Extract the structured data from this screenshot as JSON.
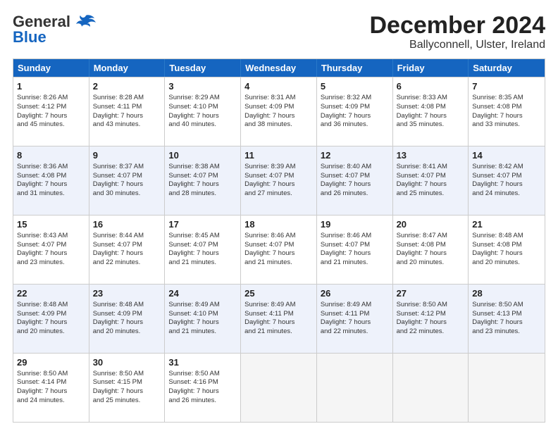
{
  "header": {
    "logo_general": "General",
    "logo_blue": "Blue",
    "title": "December 2024",
    "subtitle": "Ballyconnell, Ulster, Ireland"
  },
  "weekdays": [
    "Sunday",
    "Monday",
    "Tuesday",
    "Wednesday",
    "Thursday",
    "Friday",
    "Saturday"
  ],
  "rows": [
    [
      {
        "day": "1",
        "lines": [
          "Sunrise: 8:26 AM",
          "Sunset: 4:12 PM",
          "Daylight: 7 hours",
          "and 45 minutes."
        ]
      },
      {
        "day": "2",
        "lines": [
          "Sunrise: 8:28 AM",
          "Sunset: 4:11 PM",
          "Daylight: 7 hours",
          "and 43 minutes."
        ]
      },
      {
        "day": "3",
        "lines": [
          "Sunrise: 8:29 AM",
          "Sunset: 4:10 PM",
          "Daylight: 7 hours",
          "and 40 minutes."
        ]
      },
      {
        "day": "4",
        "lines": [
          "Sunrise: 8:31 AM",
          "Sunset: 4:09 PM",
          "Daylight: 7 hours",
          "and 38 minutes."
        ]
      },
      {
        "day": "5",
        "lines": [
          "Sunrise: 8:32 AM",
          "Sunset: 4:09 PM",
          "Daylight: 7 hours",
          "and 36 minutes."
        ]
      },
      {
        "day": "6",
        "lines": [
          "Sunrise: 8:33 AM",
          "Sunset: 4:08 PM",
          "Daylight: 7 hours",
          "and 35 minutes."
        ]
      },
      {
        "day": "7",
        "lines": [
          "Sunrise: 8:35 AM",
          "Sunset: 4:08 PM",
          "Daylight: 7 hours",
          "and 33 minutes."
        ]
      }
    ],
    [
      {
        "day": "8",
        "lines": [
          "Sunrise: 8:36 AM",
          "Sunset: 4:08 PM",
          "Daylight: 7 hours",
          "and 31 minutes."
        ]
      },
      {
        "day": "9",
        "lines": [
          "Sunrise: 8:37 AM",
          "Sunset: 4:07 PM",
          "Daylight: 7 hours",
          "and 30 minutes."
        ]
      },
      {
        "day": "10",
        "lines": [
          "Sunrise: 8:38 AM",
          "Sunset: 4:07 PM",
          "Daylight: 7 hours",
          "and 28 minutes."
        ]
      },
      {
        "day": "11",
        "lines": [
          "Sunrise: 8:39 AM",
          "Sunset: 4:07 PM",
          "Daylight: 7 hours",
          "and 27 minutes."
        ]
      },
      {
        "day": "12",
        "lines": [
          "Sunrise: 8:40 AM",
          "Sunset: 4:07 PM",
          "Daylight: 7 hours",
          "and 26 minutes."
        ]
      },
      {
        "day": "13",
        "lines": [
          "Sunrise: 8:41 AM",
          "Sunset: 4:07 PM",
          "Daylight: 7 hours",
          "and 25 minutes."
        ]
      },
      {
        "day": "14",
        "lines": [
          "Sunrise: 8:42 AM",
          "Sunset: 4:07 PM",
          "Daylight: 7 hours",
          "and 24 minutes."
        ]
      }
    ],
    [
      {
        "day": "15",
        "lines": [
          "Sunrise: 8:43 AM",
          "Sunset: 4:07 PM",
          "Daylight: 7 hours",
          "and 23 minutes."
        ]
      },
      {
        "day": "16",
        "lines": [
          "Sunrise: 8:44 AM",
          "Sunset: 4:07 PM",
          "Daylight: 7 hours",
          "and 22 minutes."
        ]
      },
      {
        "day": "17",
        "lines": [
          "Sunrise: 8:45 AM",
          "Sunset: 4:07 PM",
          "Daylight: 7 hours",
          "and 21 minutes."
        ]
      },
      {
        "day": "18",
        "lines": [
          "Sunrise: 8:46 AM",
          "Sunset: 4:07 PM",
          "Daylight: 7 hours",
          "and 21 minutes."
        ]
      },
      {
        "day": "19",
        "lines": [
          "Sunrise: 8:46 AM",
          "Sunset: 4:07 PM",
          "Daylight: 7 hours",
          "and 21 minutes."
        ]
      },
      {
        "day": "20",
        "lines": [
          "Sunrise: 8:47 AM",
          "Sunset: 4:08 PM",
          "Daylight: 7 hours",
          "and 20 minutes."
        ]
      },
      {
        "day": "21",
        "lines": [
          "Sunrise: 8:48 AM",
          "Sunset: 4:08 PM",
          "Daylight: 7 hours",
          "and 20 minutes."
        ]
      }
    ],
    [
      {
        "day": "22",
        "lines": [
          "Sunrise: 8:48 AM",
          "Sunset: 4:09 PM",
          "Daylight: 7 hours",
          "and 20 minutes."
        ]
      },
      {
        "day": "23",
        "lines": [
          "Sunrise: 8:48 AM",
          "Sunset: 4:09 PM",
          "Daylight: 7 hours",
          "and 20 minutes."
        ]
      },
      {
        "day": "24",
        "lines": [
          "Sunrise: 8:49 AM",
          "Sunset: 4:10 PM",
          "Daylight: 7 hours",
          "and 21 minutes."
        ]
      },
      {
        "day": "25",
        "lines": [
          "Sunrise: 8:49 AM",
          "Sunset: 4:11 PM",
          "Daylight: 7 hours",
          "and 21 minutes."
        ]
      },
      {
        "day": "26",
        "lines": [
          "Sunrise: 8:49 AM",
          "Sunset: 4:11 PM",
          "Daylight: 7 hours",
          "and 22 minutes."
        ]
      },
      {
        "day": "27",
        "lines": [
          "Sunrise: 8:50 AM",
          "Sunset: 4:12 PM",
          "Daylight: 7 hours",
          "and 22 minutes."
        ]
      },
      {
        "day": "28",
        "lines": [
          "Sunrise: 8:50 AM",
          "Sunset: 4:13 PM",
          "Daylight: 7 hours",
          "and 23 minutes."
        ]
      }
    ],
    [
      {
        "day": "29",
        "lines": [
          "Sunrise: 8:50 AM",
          "Sunset: 4:14 PM",
          "Daylight: 7 hours",
          "and 24 minutes."
        ]
      },
      {
        "day": "30",
        "lines": [
          "Sunrise: 8:50 AM",
          "Sunset: 4:15 PM",
          "Daylight: 7 hours",
          "and 25 minutes."
        ]
      },
      {
        "day": "31",
        "lines": [
          "Sunrise: 8:50 AM",
          "Sunset: 4:16 PM",
          "Daylight: 7 hours",
          "and 26 minutes."
        ]
      },
      null,
      null,
      null,
      null
    ]
  ]
}
